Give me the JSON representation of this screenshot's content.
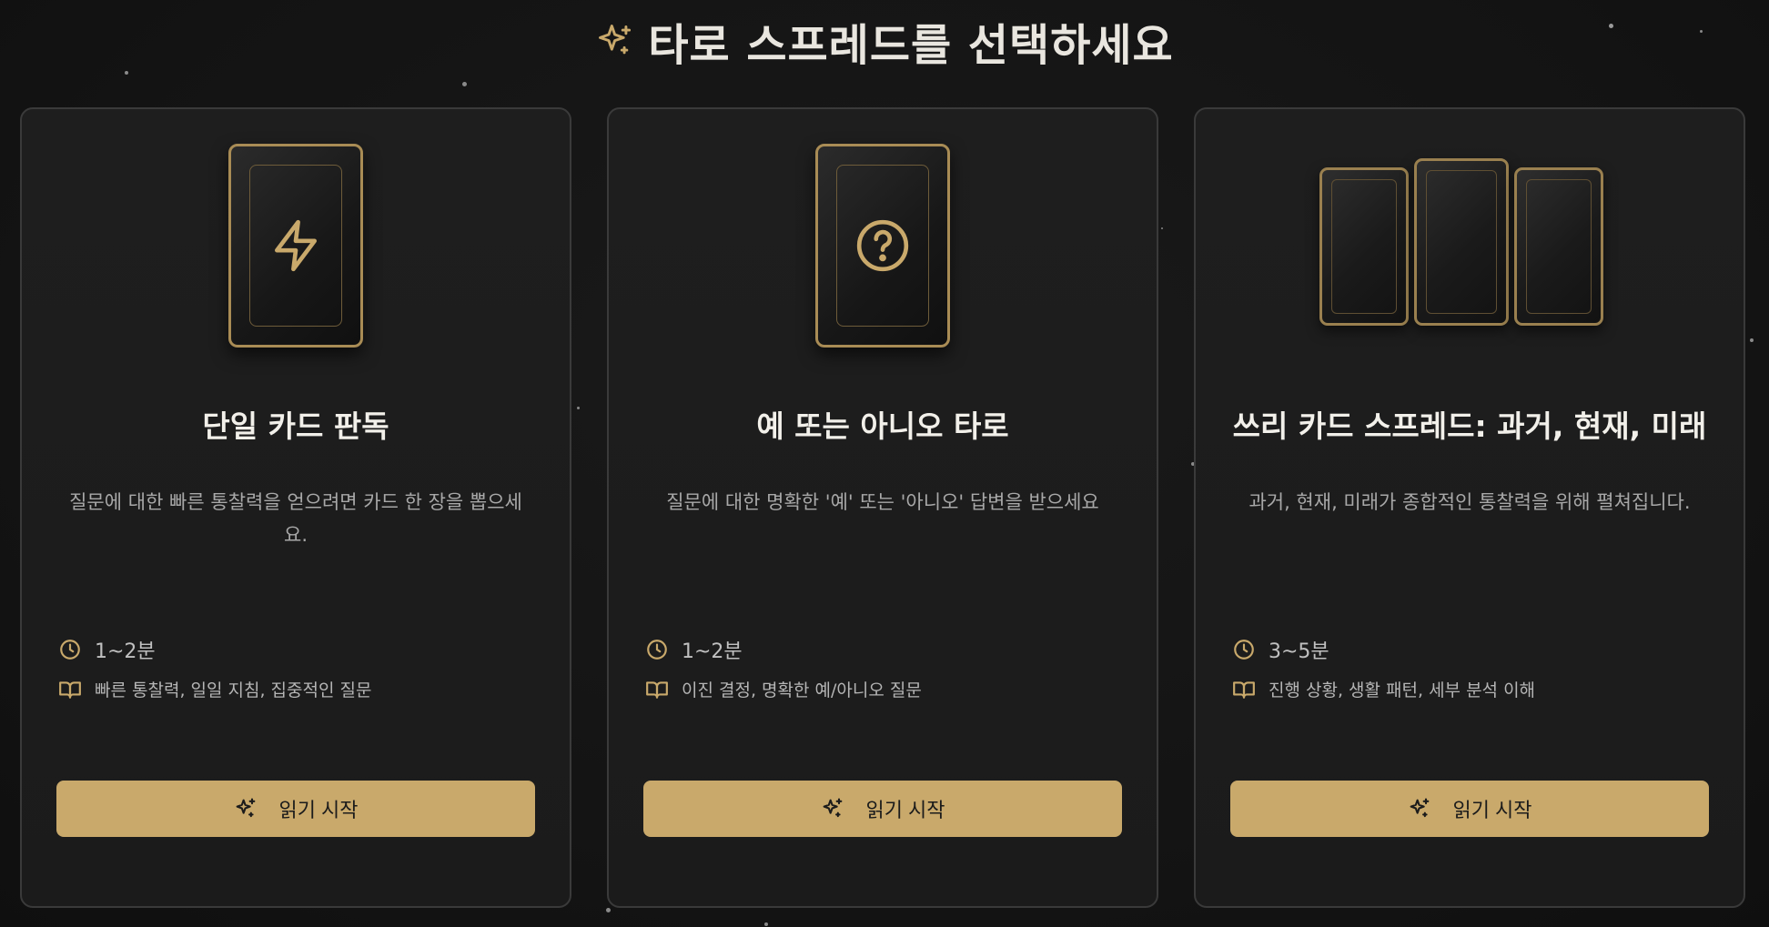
{
  "header": {
    "title": "타로 스프레드를 선택하세요",
    "icon": "sparkles-icon"
  },
  "colors": {
    "accent": "#c9a96b",
    "card_border": "#a98c55",
    "background": "#141414",
    "card_background": "#1e1e1e"
  },
  "cards": [
    {
      "art_icon": "lightning-icon",
      "title": "단일 카드 판독",
      "description": "질문에 대한 빠른 통찰력을 얻으려면 카드 한 장을 뽑으세요.",
      "duration": "1~2분",
      "best_for": "빠른 통찰력, 일일 지침, 집중적인 질문",
      "button_label": "읽기 시작"
    },
    {
      "art_icon": "question-circle-icon",
      "title": "예 또는 아니오 타로",
      "description": "질문에 대한 명확한 '예' 또는 '아니오' 답변을 받으세요",
      "duration": "1~2분",
      "best_for": "이진 결정, 명확한 예/아니오 질문",
      "button_label": "읽기 시작"
    },
    {
      "art_icon": "three-cards-icon",
      "title": "쓰리 카드 스프레드: 과거, 현재, 미래",
      "description": "과거, 현재, 미래가 종합적인 통찰력을 위해 펼쳐집니다.",
      "duration": "3~5분",
      "best_for": "진행 상황, 생활 패턴, 세부 분석 이해",
      "button_label": "읽기 시작"
    }
  ]
}
